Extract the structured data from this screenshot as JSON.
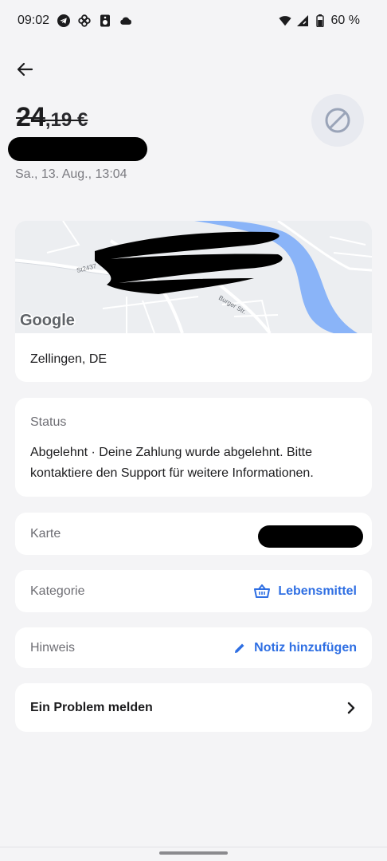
{
  "status_bar": {
    "time": "09:02",
    "left_icons": [
      "telegram-icon",
      "pinwheel-icon",
      "speaker-icon",
      "cloud-icon"
    ],
    "right_icons": [
      "wifi-icon",
      "signal-icon",
      "battery-icon"
    ],
    "battery": "60 %"
  },
  "transaction": {
    "amount_major": "24",
    "amount_minor": ",19 €",
    "date": "Sa., 13. Aug., 13:04",
    "blocked_icon": "blocked-icon"
  },
  "map": {
    "road_label_1": "St2437",
    "road_label_2": "Burger Str.",
    "attribution": "Google",
    "location": "Zellingen, DE"
  },
  "status": {
    "title": "Status",
    "text": "Abgelehnt · Deine Zahlung wurde abgelehnt. Bitte kontaktiere den Support für weitere Informationen."
  },
  "card": {
    "label": "Karte"
  },
  "category": {
    "label": "Kategorie",
    "value": "Lebensmittel",
    "icon": "basket-icon"
  },
  "note": {
    "label": "Hinweis",
    "action": "Notiz hinzufügen",
    "icon": "pencil-icon"
  },
  "report": {
    "label": "Ein Problem melden",
    "icon": "chevron-right-icon"
  },
  "colors": {
    "accent": "#2f6fe3",
    "background": "#f4f4f6",
    "card": "#ffffff",
    "muted": "#6e6e74"
  }
}
